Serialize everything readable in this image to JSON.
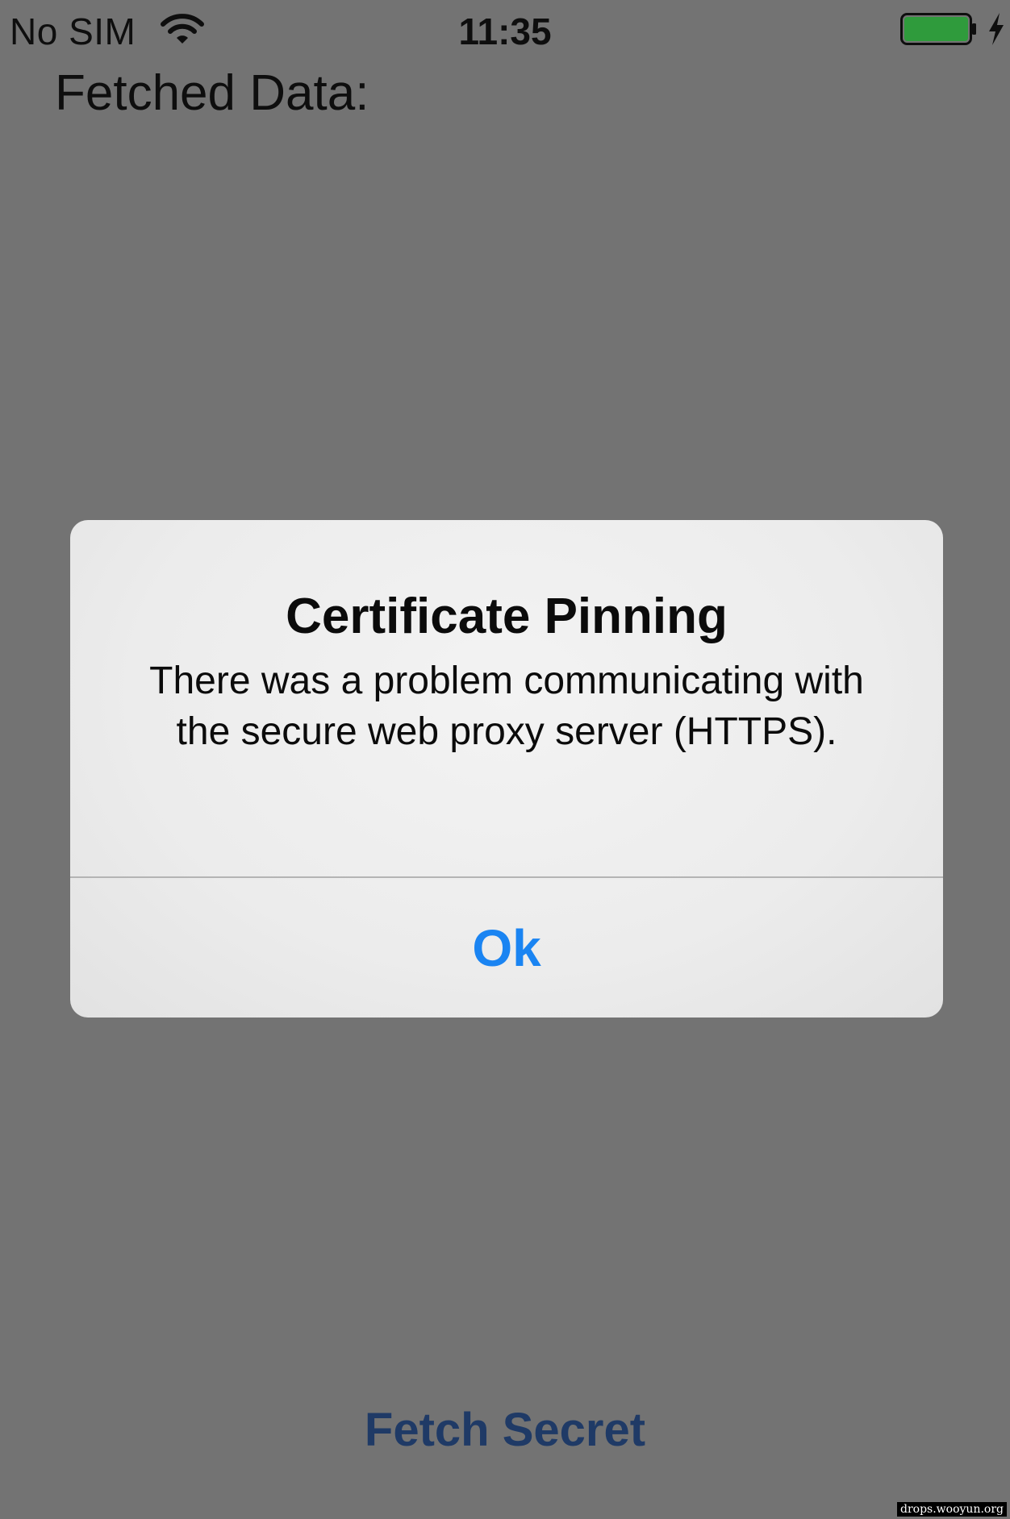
{
  "status_bar": {
    "carrier": "No SIM",
    "time": "11:35",
    "wifi_icon": "wifi-icon",
    "battery_icon": "battery-icon",
    "charging_icon": "charging-bolt-icon",
    "battery_level": 1.0,
    "battery_color": "#2f9b3c"
  },
  "content": {
    "fetched_label": "Fetched Data:",
    "fetch_button_label": "Fetch Secret",
    "fetch_button_color": "#1f3a66"
  },
  "alert": {
    "title": "Certificate Pinning",
    "message": "There was a problem communicating with the secure web proxy server (HTTPS).",
    "ok_label": "Ok",
    "ok_color": "#1a84f2"
  },
  "watermark": "drops.wooyun.org",
  "colors": {
    "dim_background": "#737373",
    "alert_background": "#eeeeee"
  }
}
